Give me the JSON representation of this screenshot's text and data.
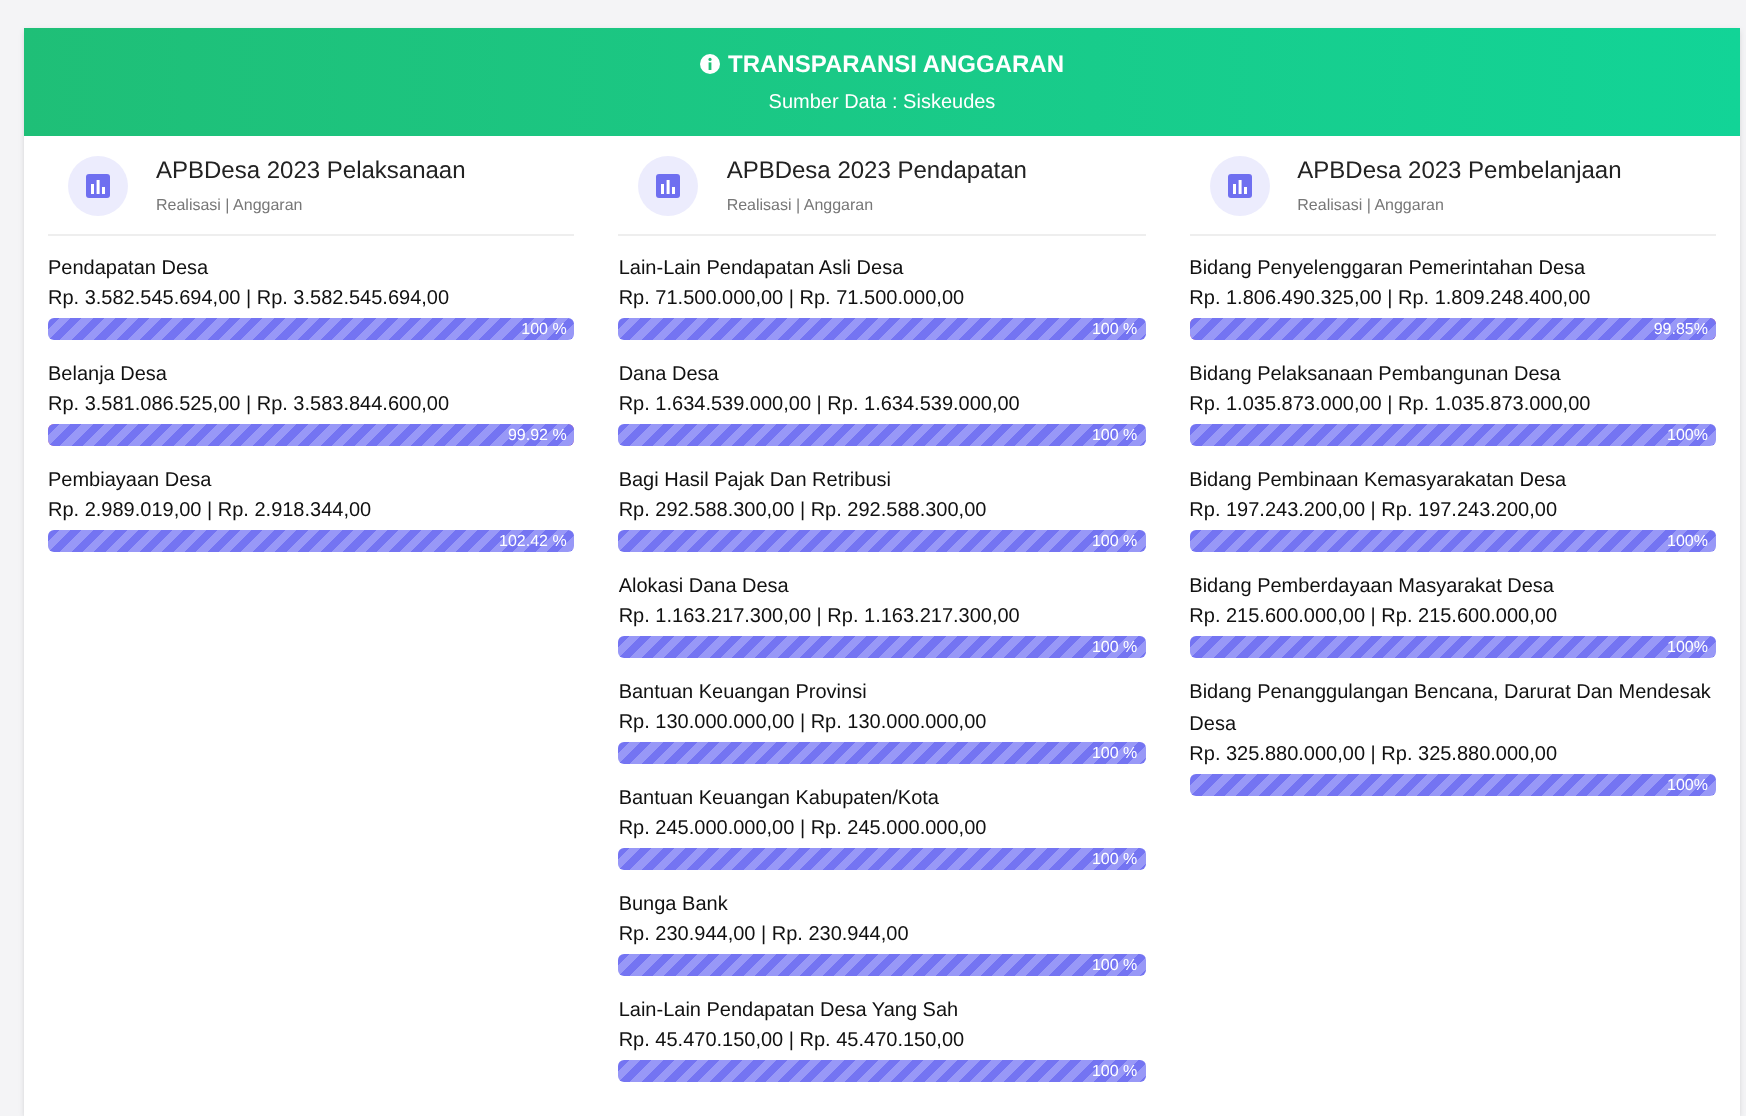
{
  "header": {
    "title": "TRANSPARANSI ANGGARAN",
    "subtitle": "Sumber Data : Siskeudes"
  },
  "columns": [
    {
      "title": "APBDesa 2023 Pelaksanaan",
      "subtitle": "Realisasi | Anggaran",
      "items": [
        {
          "label": "Pendapatan Desa",
          "amount": "Rp. 3.582.545.694,00 | Rp. 3.582.545.694,00",
          "level": 1,
          "percent": "100 %"
        },
        {
          "label": "Belanja Desa",
          "amount": "Rp. 3.581.086.525,00 | Rp. 3.583.844.600,00",
          "level": 0.9992,
          "percent": "99.92 %"
        },
        {
          "label": "Pembiayaan Desa",
          "amount": "Rp. 2.989.019,00 | Rp. 2.918.344,00",
          "level": 1,
          "percent": "102.42 %"
        }
      ]
    },
    {
      "title": "APBDesa 2023 Pendapatan",
      "subtitle": "Realisasi | Anggaran",
      "items": [
        {
          "label": "Lain-Lain Pendapatan Asli Desa",
          "amount": "Rp. 71.500.000,00 | Rp. 71.500.000,00",
          "level": 1,
          "percent": "100 %"
        },
        {
          "label": "Dana Desa",
          "amount": "Rp. 1.634.539.000,00 | Rp. 1.634.539.000,00",
          "level": 1,
          "percent": "100 %"
        },
        {
          "label": "Bagi Hasil Pajak Dan Retribusi",
          "amount": "Rp. 292.588.300,00 | Rp. 292.588.300,00",
          "level": 1,
          "percent": "100 %"
        },
        {
          "label": "Alokasi Dana Desa",
          "amount": "Rp. 1.163.217.300,00 | Rp. 1.163.217.300,00",
          "level": 1,
          "percent": "100 %"
        },
        {
          "label": "Bantuan Keuangan Provinsi",
          "amount": "Rp. 130.000.000,00 | Rp. 130.000.000,00",
          "level": 1,
          "percent": "100 %"
        },
        {
          "label": "Bantuan Keuangan Kabupaten/Kota",
          "amount": "Rp. 245.000.000,00 | Rp. 245.000.000,00",
          "level": 1,
          "percent": "100 %"
        },
        {
          "label": "Bunga Bank",
          "amount": "Rp. 230.944,00 | Rp. 230.944,00",
          "level": 1,
          "percent": "100 %"
        },
        {
          "label": "Lain-Lain Pendapatan Desa Yang Sah",
          "amount": "Rp. 45.470.150,00 | Rp. 45.470.150,00",
          "level": 1,
          "percent": "100 %"
        }
      ]
    },
    {
      "title": "APBDesa 2023 Pembelanjaan",
      "subtitle": "Realisasi | Anggaran",
      "items": [
        {
          "label": "Bidang Penyelenggaran Pemerintahan Desa",
          "amount": "Rp. 1.806.490.325,00 | Rp. 1.809.248.400,00",
          "level": 0.9985,
          "percent": "99.85%"
        },
        {
          "label": "Bidang Pelaksanaan Pembangunan Desa",
          "amount": "Rp. 1.035.873.000,00 | Rp. 1.035.873.000,00",
          "level": 1,
          "percent": "100%"
        },
        {
          "label": "Bidang Pembinaan Kemasyarakatan Desa",
          "amount": "Rp. 197.243.200,00 | Rp. 197.243.200,00",
          "level": 1,
          "percent": "100%"
        },
        {
          "label": "Bidang Pemberdayaan Masyarakat Desa",
          "amount": "Rp. 215.600.000,00 | Rp. 215.600.000,00",
          "level": 1,
          "percent": "100%"
        },
        {
          "label": "Bidang Penanggulangan Bencana, Darurat Dan Mendesak Desa",
          "amount": "Rp. 325.880.000,00 | Rp. 325.880.000,00",
          "level": 1,
          "percent": "100%"
        }
      ]
    }
  ]
}
